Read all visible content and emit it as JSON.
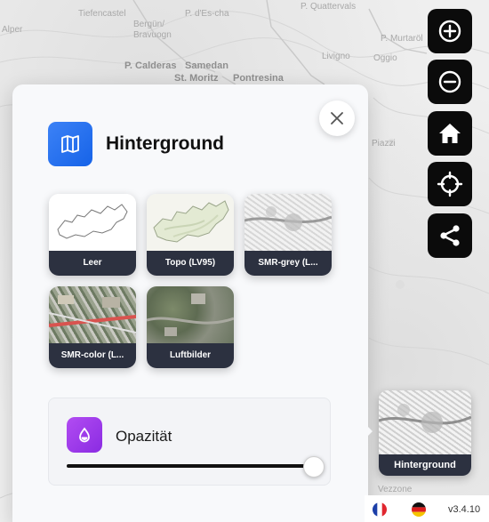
{
  "map": {
    "labels": [
      {
        "text": "Tiefencastel",
        "cls": ""
      },
      {
        "text": "Bergün/",
        "cls": ""
      },
      {
        "text": "Bravuogn",
        "cls": ""
      },
      {
        "text": "Alper",
        "cls": ""
      },
      {
        "text": "P. d'Es-cha",
        "cls": ""
      },
      {
        "text": "P. Quattervals",
        "cls": ""
      },
      {
        "text": "P. Calderas",
        "cls": "town"
      },
      {
        "text": "Samedan",
        "cls": "town"
      },
      {
        "text": "St. Moritz",
        "cls": "town"
      },
      {
        "text": "Pontresina",
        "cls": "town"
      },
      {
        "text": "Livigno",
        "cls": ""
      },
      {
        "text": "P. Murtaröl",
        "cls": ""
      },
      {
        "text": "Piazzi",
        "cls": ""
      },
      {
        "text": "Vezzone",
        "cls": ""
      },
      {
        "text": "Oggio",
        "cls": ""
      }
    ]
  },
  "controls": {
    "zoom_in": "zoom-in",
    "zoom_out": "zoom-out",
    "home": "home",
    "locate": "locate",
    "share": "share"
  },
  "panel": {
    "title": "Hinterground",
    "tiles": [
      {
        "label": "Leer"
      },
      {
        "label": "Topo (LV95)"
      },
      {
        "label": "SMR-grey (L..."
      },
      {
        "label": "SMR-color (L..."
      },
      {
        "label": "Luftbilder"
      }
    ],
    "opacity": {
      "label": "Opazität",
      "value": 0.98
    }
  },
  "preview": {
    "label": "Hinterground"
  },
  "footer": {
    "version": "v3.4.10",
    "languages": [
      "fr",
      "de"
    ]
  },
  "colors": {
    "accent_blue": "#1f6cf0",
    "accent_purple": "#a23ee8",
    "tile_caption": "#2c3140",
    "control_bg": "#0b0b0b"
  }
}
